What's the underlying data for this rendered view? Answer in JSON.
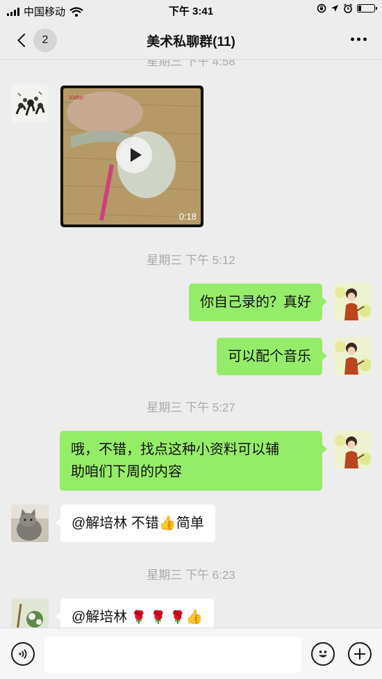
{
  "status_bar": {
    "carrier": "中国移动",
    "time": "下午 3:41",
    "battery_level": 0.2
  },
  "nav": {
    "back_count": "2",
    "title": "美术私聊群(11)"
  },
  "messages": {
    "ts_0": "星期三 下午 4:58",
    "video_duration": "0:18",
    "ts_1": "星期三 下午 5:12",
    "out_1": "你自己录的？真好",
    "out_2": "可以配个音乐",
    "ts_2": "星期三 下午 5:27",
    "out_3_line1": "哦，不错，找点这种小资料可以辅",
    "out_3_line2": "助咱们下周的内容",
    "in_1_text": "@解培林 不错",
    "in_1_suffix": "简单",
    "ts_3": "星期三 下午 6:23",
    "in_2_text": "@解培林 "
  },
  "icons": {
    "voice": "voice-icon",
    "emoji": "emoji-icon",
    "plus": "plus-icon",
    "play": "play-icon",
    "thumbs_up": "thumbs-up-icon",
    "rose": "rose-icon"
  },
  "colors": {
    "out_bubble": "#95ec69",
    "in_bubble": "#ffffff",
    "background": "#ededed"
  }
}
